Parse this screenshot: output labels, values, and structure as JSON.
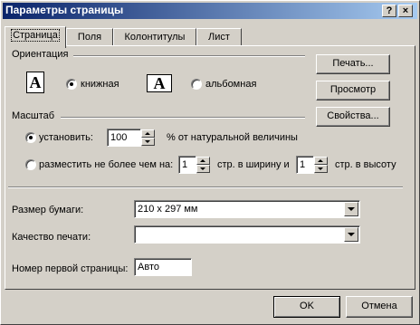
{
  "window": {
    "title": "Параметры страницы",
    "help_btn": "?",
    "close_btn": "×"
  },
  "tabs": [
    {
      "label": "Страница",
      "active": true
    },
    {
      "label": "Поля",
      "active": false
    },
    {
      "label": "Колонтитулы",
      "active": false
    },
    {
      "label": "Лист",
      "active": false
    }
  ],
  "orientation": {
    "group_label": "Ориентация",
    "portrait_icon": "A",
    "portrait_label": "книжная",
    "portrait_selected": true,
    "landscape_icon": "A",
    "landscape_label": "альбомная",
    "landscape_selected": false
  },
  "scale": {
    "group_label": "Масштаб",
    "set_label": "установить:",
    "set_value": "100",
    "set_suffix": "% от натуральной величины",
    "set_selected": true,
    "fit_label": "разместить не более чем на:",
    "fit_selected": false,
    "fit_wide_value": "1",
    "fit_wide_suffix": "стр. в ширину и",
    "fit_tall_value": "1",
    "fit_tall_suffix": "стр. в высоту"
  },
  "paper": {
    "size_label": "Размер бумаги:",
    "size_value": "210 x 297 мм",
    "quality_label": "Качество печати:",
    "quality_value": "",
    "first_page_label": "Номер первой страницы:",
    "first_page_value": "Авто"
  },
  "side_buttons": {
    "print": "Печать...",
    "preview": "Просмотр",
    "properties": "Свойства..."
  },
  "footer": {
    "ok": "OK",
    "cancel": "Отмена"
  }
}
